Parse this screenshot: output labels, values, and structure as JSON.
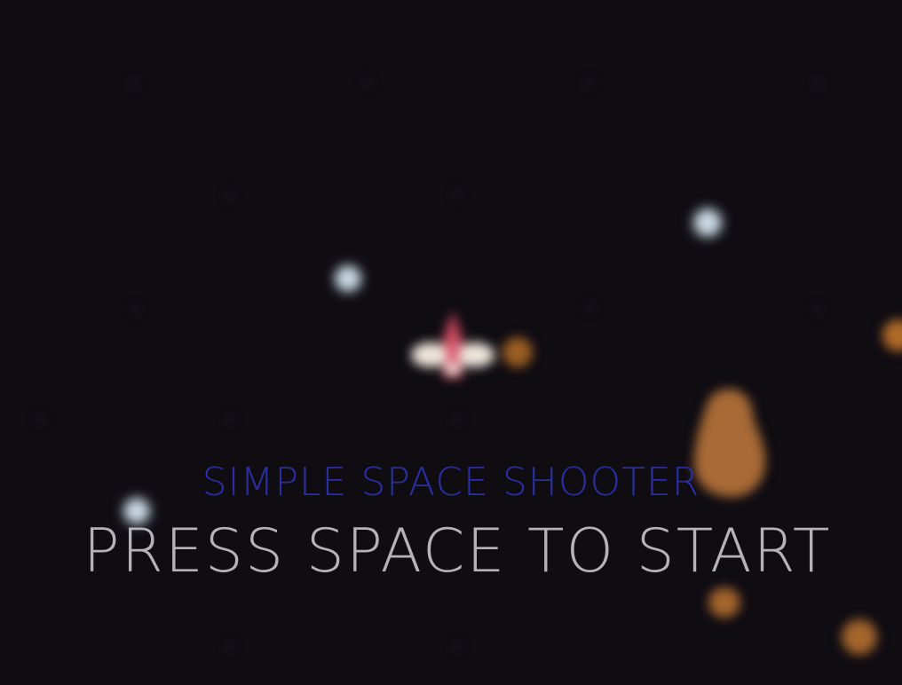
{
  "game": {
    "title": "SIMPLE SPACE SHOOTER",
    "prompt": "PRESS SPACE TO START"
  },
  "colors": {
    "background": "#0f0c12",
    "title": "#2a2fa0",
    "prompt": "#b4b4b8",
    "star": "#c9d8e2",
    "asteroid": "#a86a36",
    "ship_body": "#e9e0d8",
    "ship_accent": "#c0455a"
  },
  "sprites": {
    "player": "player-ship-icon",
    "star": "star-icon",
    "asteroid": "asteroid-icon",
    "projectile": "orange-orb-icon"
  }
}
